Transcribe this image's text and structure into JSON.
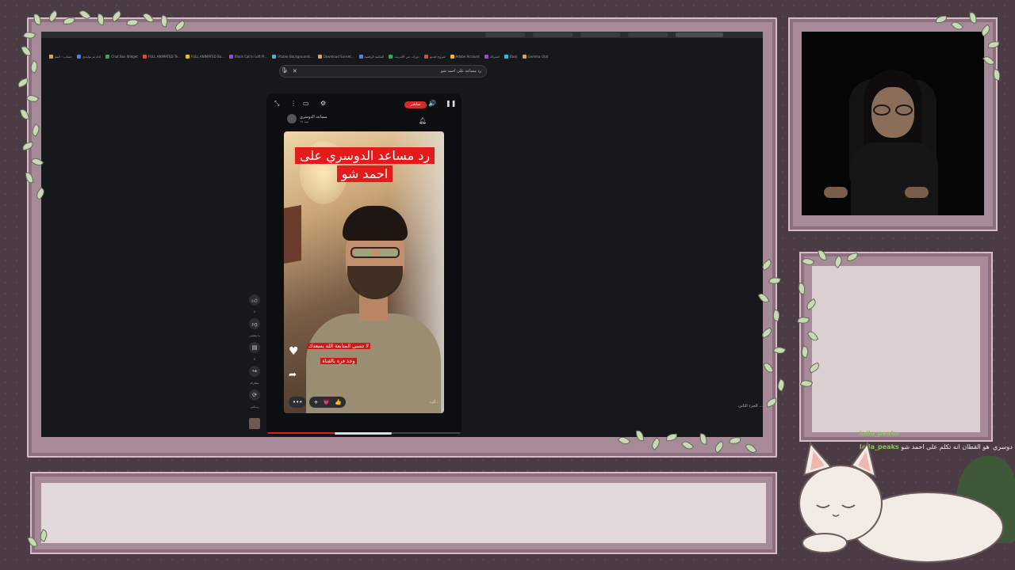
{
  "browser": {
    "bookmarks": [
      "حساب - اسم",
      "اداة تم توليدي",
      "Chat Box Widget",
      "FULL ANIMATED Te...",
      "FULL ANIMATED Ba...",
      "Black Cat In Loft Pl...",
      "Vtuber Backgrounds...",
      "Download Sunset...",
      "المكتبة الرقمية",
      "دورات عن الانترنت",
      "شروح فيديو",
      "Adobe Account",
      "اشتراك",
      "Bask",
      "Gemma chat"
    ],
    "search": {
      "query": "رد مساعد على احمد شو"
    }
  },
  "short": {
    "live_label": "مباشر",
    "channel_name": "مساعد الدوسري",
    "channel_sub": "منذ ١٩",
    "title_lines": [
      "رد مساعد الدوسري على",
      "احمد شو"
    ],
    "caption_lines": [
      "لا تنسى المتابعة الله يسعدك",
      "وخذ فره بالقناة"
    ],
    "bottom_title": "الرد...",
    "more_label": "•••",
    "plus_label": "+",
    "heart_emoji": "💗",
    "thumb_emoji": "👍",
    "progress": 0.35
  },
  "actions": [
    {
      "icon": "like-icon",
      "label": "2"
    },
    {
      "icon": "dislike-icon",
      "label": "ما يعجبني"
    },
    {
      "icon": "comment-icon",
      "label": "0"
    },
    {
      "icon": "share-icon",
      "label": "مشاركة"
    },
    {
      "icon": "remix-icon",
      "label": "ريمكس"
    }
  ],
  "stream_chat_overlay": "الجزء الثاني ...",
  "chat": [
    {
      "user": "laila_peaks",
      "message": ""
    },
    {
      "user": "laila_peaks",
      "message": "هو القطان انه تكلم على احمد شو"
    }
  ],
  "chat_overflow": "دوسري"
}
